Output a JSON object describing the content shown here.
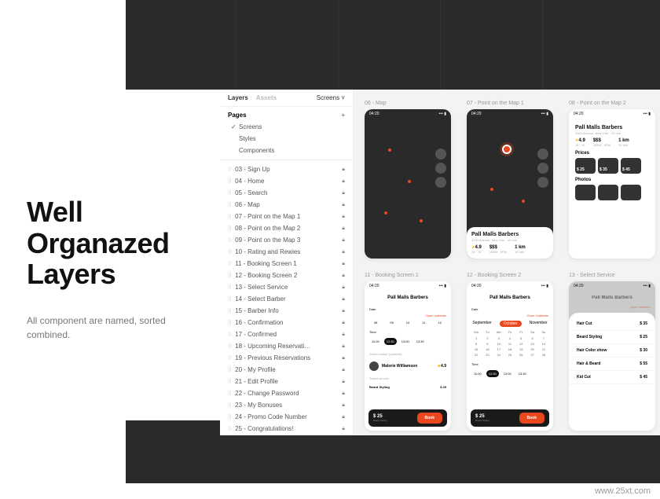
{
  "promo": {
    "title_l1": "Well",
    "title_l2": "Organazed",
    "title_l3": "Layers",
    "subtitle": "All component are named, sorted combined."
  },
  "panel": {
    "tabs": {
      "layers": "Layers",
      "assets": "Assets",
      "screens": "Screens"
    },
    "pages_label": "Pages",
    "plus": "+",
    "pages": [
      {
        "label": "Screens",
        "checked": true
      },
      {
        "label": "Styles",
        "checked": false
      },
      {
        "label": "Components",
        "checked": false
      }
    ],
    "layers": [
      "03 - Sign Up",
      "04 - Home",
      "05 - Search",
      "06 - Map",
      "07 - Point on the Map 1",
      "08 - Point on the Map 2",
      "09 - Point on the Map 3",
      "10 - Rating and Rewies",
      "11 - Booking Screen 1",
      "12 - Booking Screen 2",
      "13 - Select Service",
      "14 - Select Barber",
      "15 - Barber Info",
      "16 - Confirmation",
      "17 - Confirmed",
      "18 - Upcoming Reservati…",
      "19 - Previous Reservations",
      "20 - My Profile",
      "21 - Edit Profile",
      "22 - Change Password",
      "23 - My Bonuses",
      "24 - Promo Code Number",
      "25 - Congratulations!"
    ]
  },
  "artboards_top": [
    {
      "label": "06 - Map"
    },
    {
      "label": "07 - Point on the Map 1"
    },
    {
      "label": "08 - Point on the Map 2"
    }
  ],
  "artboards_bottom": [
    {
      "label": "11 - Booking Screen 1"
    },
    {
      "label": "12 - Booking Screen 2"
    },
    {
      "label": "13 - Select Service"
    }
  ],
  "status_time": "04:20",
  "barbershop": {
    "name": "Pall Malls Barbers",
    "address": "1000 Avenue, New York · 10 min",
    "rating": "4.9",
    "price": "$$$",
    "distance": "1 km",
    "rating_lbl": "15 - 16",
    "price_lbl": "10AM - 9PM",
    "distance_lbl": "10 min",
    "prices_label": "Prices",
    "photos_label": "Photos",
    "price1": "$ 25",
    "price2": "$ 35",
    "price3": "$ 45"
  },
  "booking": {
    "open_calendar": "Open calendar",
    "close_calendar": "Close Calendar",
    "date_lbl": "Date",
    "time_lbl": "Time",
    "dates": [
      "08",
      "09",
      "10",
      "11",
      "12"
    ],
    "times": [
      "11:00",
      "12:30",
      "13:00",
      "13:30"
    ],
    "selected_time": "12:30",
    "select_barber_lbl": "Select barber (optional)",
    "barber_name": "Malorie Williamson",
    "barber_rating": "4.9",
    "select_service_lbl": "Select service",
    "service_name": "Beard Styling",
    "service_price": "$ 25",
    "footer_price": "$ 25",
    "footer_sub": "Beard Styling",
    "book_btn": "Book"
  },
  "calendar": {
    "months": [
      "September",
      "October",
      "November"
    ],
    "days": [
      "Mo",
      "Tu",
      "We",
      "Th",
      "Fr",
      "Sa",
      "Su"
    ]
  },
  "services": [
    {
      "name": "Hair Cut",
      "price": "$ 35"
    },
    {
      "name": "Beard Styling",
      "price": "$ 25"
    },
    {
      "name": "Hair Color show",
      "price": "$ 30"
    },
    {
      "name": "Hair & Beard",
      "price": "$ 55"
    },
    {
      "name": "Kid Cut",
      "price": "$ 45"
    }
  ],
  "watermark": "www.25xt.com"
}
